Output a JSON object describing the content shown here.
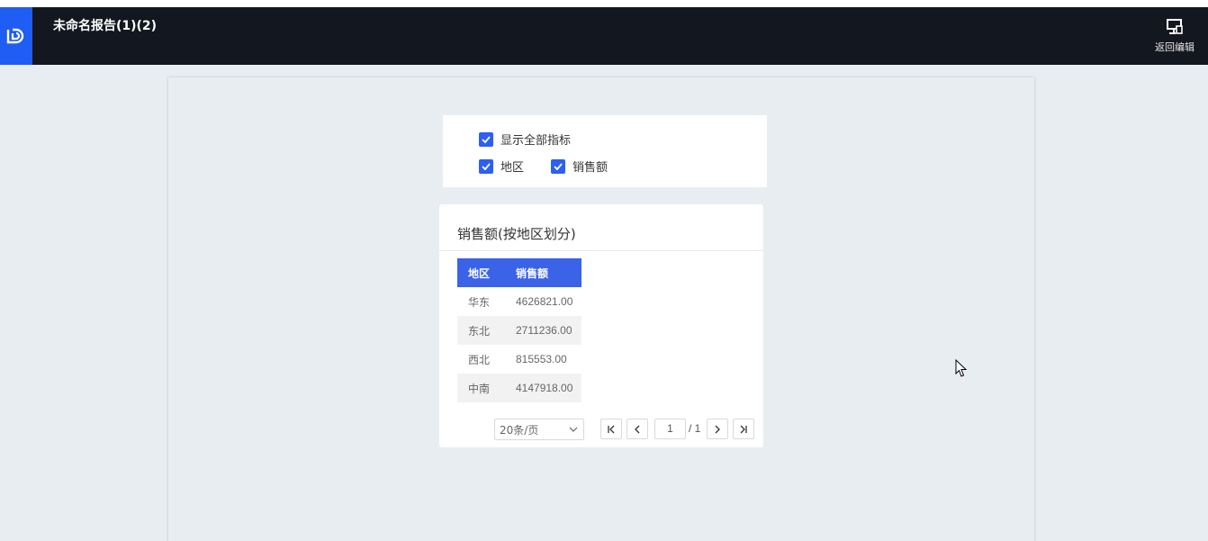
{
  "header": {
    "title": "未命名报告(1)(2)",
    "back_edit_label": "返回编辑"
  },
  "filters": {
    "show_all_label": "显示全部指标",
    "show_all_checked": true,
    "indicators": [
      {
        "label": "地区",
        "checked": true
      },
      {
        "label": "销售额",
        "checked": true
      }
    ]
  },
  "table_card": {
    "title": "销售额(按地区划分)",
    "columns": [
      "地区",
      "销售额"
    ],
    "rows": [
      [
        "华东",
        "4626821.00"
      ],
      [
        "东北",
        "2711236.00"
      ],
      [
        "西北",
        "815553.00"
      ],
      [
        "中南",
        "4147918.00"
      ]
    ],
    "pager": {
      "page_size": "20条/页",
      "current_page": "1",
      "total_pages": "/ 1"
    }
  },
  "colors": {
    "topbar": "#13171f",
    "logo": "#1f5df5",
    "accent": "#3a63e8"
  }
}
